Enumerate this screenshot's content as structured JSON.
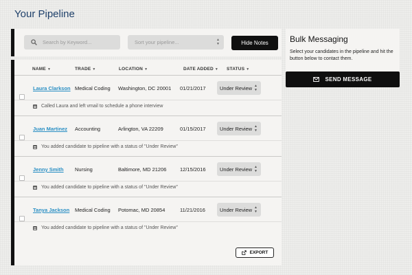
{
  "page": {
    "title": "Your Pipeline"
  },
  "toolbar": {
    "search_placeholder": "Search by Keyword...",
    "sort_placeholder": "Sort your pipeline...",
    "hide_notes_label": "Hide Notes"
  },
  "table": {
    "columns": {
      "name": "NAME",
      "trade": "TRADE",
      "location": "LOCATION",
      "date_added": "DATE ADDED",
      "status": "STATUS"
    },
    "rows": [
      {
        "name": "Laura Clarkson",
        "trade": "Medical Coding",
        "location": "Washington, DC 20001",
        "date_added": "01/21/2017",
        "status": "Under Review",
        "note": "Called Laura and left vmail to schedule a phone interview"
      },
      {
        "name": "Juan Martinez",
        "trade": "Accounting",
        "location": "Arlington, VA 22209",
        "date_added": "01/15/2017",
        "status": "Under Review",
        "note": "You added candidate to pipeline with a status of \"Under Review\""
      },
      {
        "name": "Jenny Smith",
        "trade": "Nursing",
        "location": "Baltimore, MD 21206",
        "date_added": "12/15/2016",
        "status": "Under Review",
        "note": "You added candidate to pipeline with a status of \"Under Review\""
      },
      {
        "name": "Tanya Jackson",
        "trade": "Medical Coding",
        "location": "Potomac, MD 20854",
        "date_added": "11/21/2016",
        "status": "Under Review",
        "note": "You added candidate to pipeline with a status of \"Under Review\""
      }
    ],
    "export_label": "EXPORT"
  },
  "bulk": {
    "title": "Bulk Messaging",
    "description": "Select your candidates in the pipeline and hit the button below to contact them.",
    "send_label": "SEND MESSAGE"
  },
  "colors": {
    "title": "#1d3f69",
    "link": "#2a8fc4",
    "button_dark": "#101010",
    "panel": "#f5f4f2"
  },
  "icons": {
    "search": "search-icon",
    "envelope": "envelope-icon",
    "export": "export-icon",
    "note": "note-icon"
  }
}
